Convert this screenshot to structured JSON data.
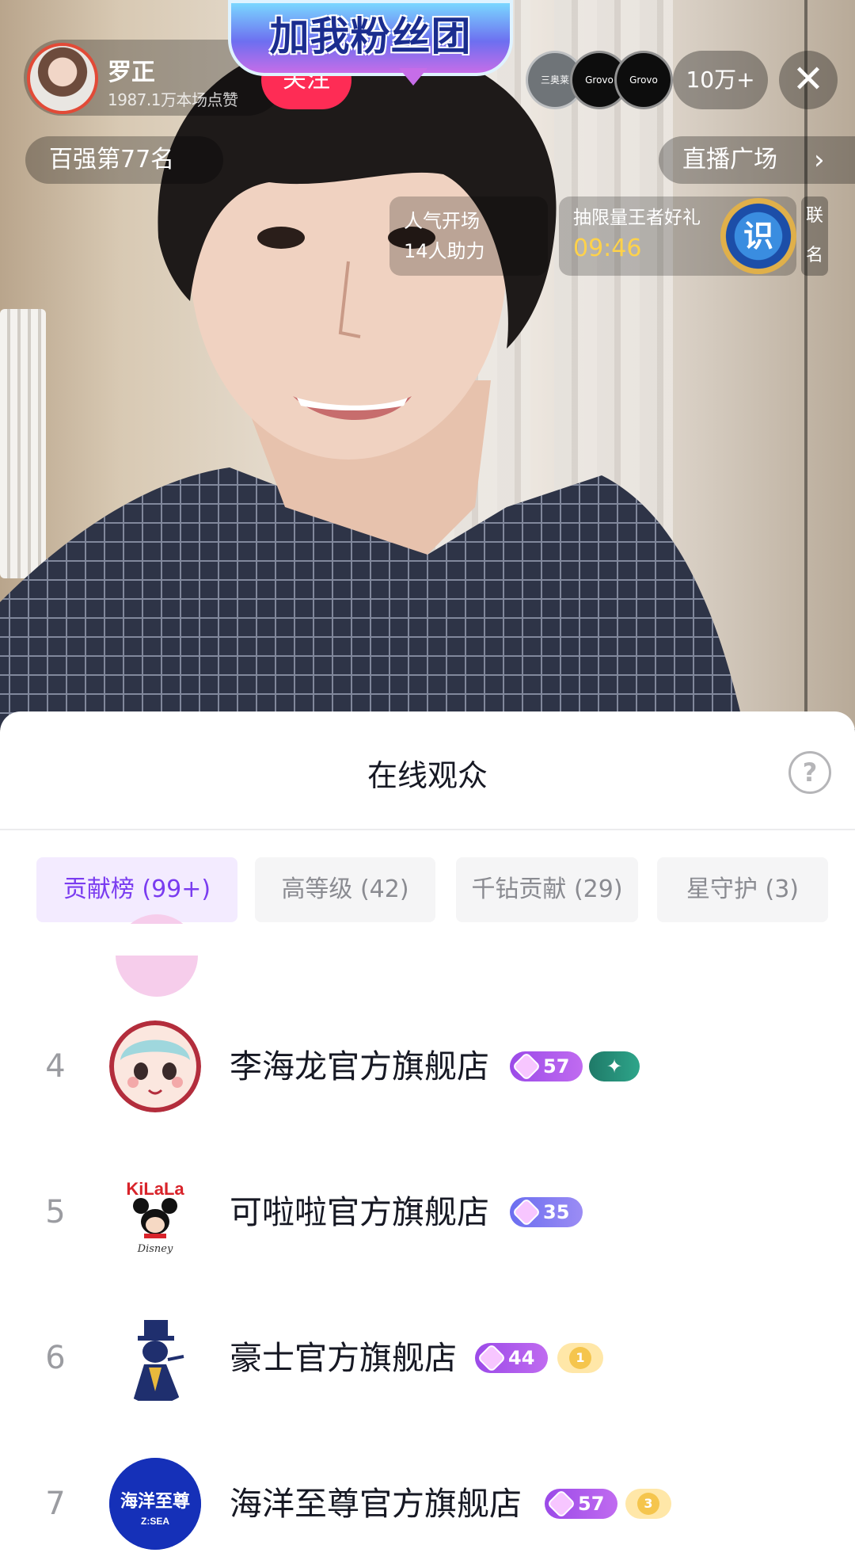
{
  "host": {
    "name": "罗正",
    "likes": "1987.1万本场点赞",
    "follow_label": "关注"
  },
  "fan_banner": "加我粉丝团",
  "viewers": {
    "avatars": [
      {
        "label": "三奥莱 CENSTO"
      },
      {
        "label": "Grovo"
      },
      {
        "label": "Grovo"
      }
    ],
    "count": "10万+"
  },
  "close_symbol": "✕",
  "rank_label": "百强第77名",
  "plaza_label": "直播广场",
  "plaza_chevron": "›",
  "popular": {
    "line1": "人气开场",
    "line2": "14人助力"
  },
  "lottery": {
    "title": "抽限量王者好礼",
    "timer": "09:46",
    "badge": "识"
  },
  "lianming": [
    "联",
    "名"
  ],
  "sheet": {
    "title": "在线观众",
    "help_symbol": "?",
    "tabs": [
      {
        "label": "贡献榜 (99+)",
        "active": true
      },
      {
        "label": "高等级 (42)",
        "active": false
      },
      {
        "label": "千钻贡献 (29)",
        "active": false
      },
      {
        "label": "星守护 (3)",
        "active": false
      }
    ]
  },
  "audience": [
    {
      "rank": "4",
      "name": "李海龙官方旗舰店",
      "level": "57",
      "level_color": "purple",
      "extra": "star",
      "extra_text": "✦"
    },
    {
      "rank": "5",
      "name": "可啦啦官方旗舰店",
      "level": "35",
      "level_color": "blue",
      "extra": "",
      "extra_text": ""
    },
    {
      "rank": "6",
      "name": "豪士官方旗舰店",
      "level": "44",
      "level_color": "purple",
      "extra": "coin",
      "extra_text": "1"
    },
    {
      "rank": "7",
      "name": "海洋至尊官方旗舰店",
      "level": "57",
      "level_color": "purple",
      "extra": "coin",
      "extra_text": "3"
    }
  ],
  "avatar_labels": {
    "kilala": "KiLaLa",
    "kilala_sub": "Disney",
    "zsea_top": "海洋至尊",
    "zsea_bottom": "Z:SEA"
  },
  "colors": {
    "follow": "#fe2c55",
    "tab_active_bg": "#f3ebff",
    "tab_active_text": "#7a3cf0",
    "timer": "#ffd24a"
  }
}
